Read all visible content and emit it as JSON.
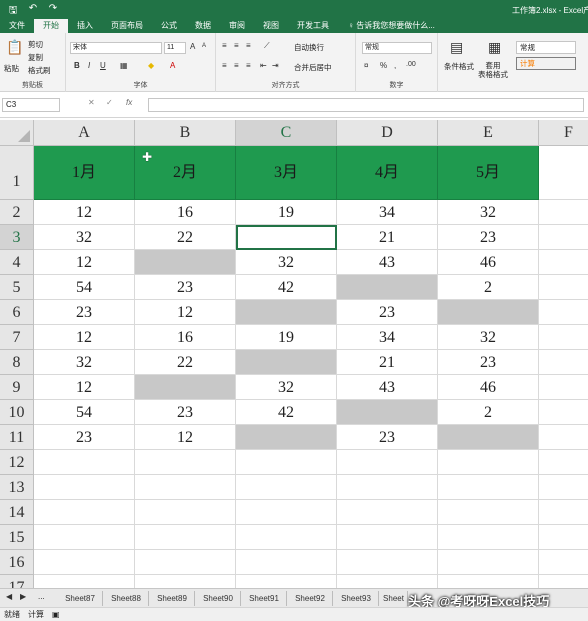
{
  "window": {
    "title": "工作簿2.xlsx - Excel产"
  },
  "qat": {
    "save_icon": "save-icon",
    "undo_icon": "undo-icon",
    "redo_icon": "redo-icon"
  },
  "tabs": [
    "文件",
    "开始",
    "插入",
    "页面布局",
    "公式",
    "数据",
    "审阅",
    "视图",
    "开发工具"
  ],
  "active_tab": 1,
  "tellme": "♀ 告诉我您想要做什么...",
  "ribbon": {
    "clipboard": {
      "paste": "粘贴",
      "cut": "剪切",
      "copy": "复制",
      "format_painter": "格式刷",
      "label": "剪贴板"
    },
    "font": {
      "name": "宋体",
      "size": "11",
      "bold": "B",
      "italic": "I",
      "underline": "U",
      "label": "字体"
    },
    "alignment": {
      "wrap": "自动换行",
      "merge": "合并后居中",
      "label": "对齐方式"
    },
    "number": {
      "format": "常规",
      "label": "数字"
    },
    "styles": {
      "conditional": "条件格式",
      "table": "套用\n表格格式",
      "normal": "常规",
      "calc": "计算"
    }
  },
  "formula_bar": {
    "namebox": "C3",
    "fx": "fx",
    "cancel": "✕",
    "enter": "✓"
  },
  "grid": {
    "columns": [
      "A",
      "B",
      "C",
      "D",
      "E",
      "F"
    ],
    "rows": [
      "1",
      "2",
      "3",
      "4",
      "5",
      "6",
      "7",
      "8",
      "9",
      "10",
      "11",
      "12",
      "13",
      "14",
      "15",
      "16",
      "17"
    ],
    "header": [
      "1月",
      "2月",
      "3月",
      "4月",
      "5月"
    ],
    "data": [
      [
        "12",
        "16",
        "19",
        "34",
        "32"
      ],
      [
        "32",
        "22",
        "",
        "21",
        "23"
      ],
      [
        "12",
        "",
        "32",
        "43",
        "46"
      ],
      [
        "54",
        "23",
        "42",
        "",
        "2"
      ],
      [
        "23",
        "12",
        "",
        "23",
        ""
      ],
      [
        "12",
        "16",
        "19",
        "34",
        "32"
      ],
      [
        "32",
        "22",
        "",
        "21",
        "23"
      ],
      [
        "12",
        "",
        "32",
        "43",
        "46"
      ],
      [
        "54",
        "23",
        "42",
        "",
        "2"
      ],
      [
        "23",
        "12",
        "",
        "23",
        ""
      ]
    ]
  },
  "sheets": [
    "Sheet87",
    "Sheet88",
    "Sheet89",
    "Sheet90",
    "Sheet91",
    "Sheet92",
    "Sheet93",
    "Sheet"
  ],
  "sheet_more": "...",
  "watermark": "头条 @考呀呀Excel技巧",
  "status": {
    "ready": "就绪",
    "calc": "计算"
  }
}
